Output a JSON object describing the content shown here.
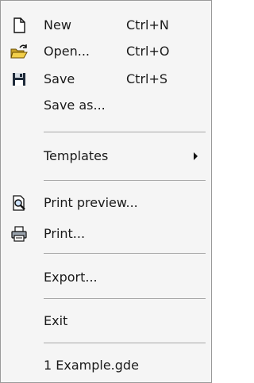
{
  "menu": {
    "items": [
      {
        "label": "New",
        "shortcut": "Ctrl+N",
        "icon": "new-file-icon"
      },
      {
        "label": "Open...",
        "shortcut": "Ctrl+O",
        "icon": "open-folder-icon"
      },
      {
        "label": "Save",
        "shortcut": "Ctrl+S",
        "icon": "save-floppy-icon"
      },
      {
        "label": "Save as..."
      },
      {
        "label": "Templates",
        "has_submenu": true
      },
      {
        "label": "Print preview...",
        "icon": "print-preview-icon"
      },
      {
        "label": "Print...",
        "icon": "printer-icon"
      },
      {
        "label": "Export..."
      },
      {
        "label": "Exit"
      },
      {
        "label": "1 Example.gde"
      }
    ]
  }
}
